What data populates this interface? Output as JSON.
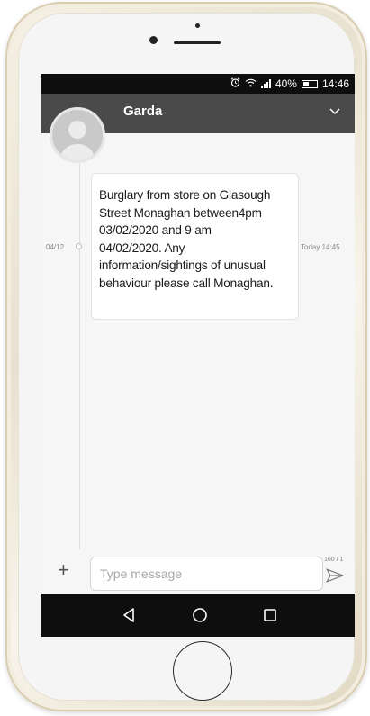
{
  "status_bar": {
    "battery": "40%",
    "battery_level": 0.4,
    "time": "14:46",
    "icons": [
      "alarm-icon",
      "wifi-icon",
      "signal-icon",
      "battery-icon"
    ]
  },
  "header": {
    "contact_name": "Garda",
    "background": "#4a4a4a"
  },
  "conversation": {
    "date": "04/12",
    "message": {
      "text": "Burglary from store on Glasough\nStreet Monaghan between4pm\n03/02/2020 and 9 am\n04/02/2020. Any\ninformation/sightings of unusual\nbehaviour please call Monaghan.",
      "time": "Today 14:45"
    }
  },
  "composer": {
    "placeholder": "Type message",
    "counter": "160 / 1"
  },
  "nav": {
    "icons": [
      "back-icon",
      "home-icon",
      "recents-icon"
    ]
  }
}
